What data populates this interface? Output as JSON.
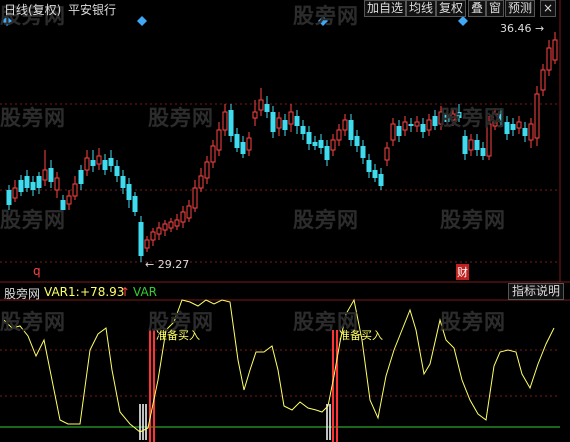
{
  "header": {
    "period": "日线(复权)",
    "stock": "平安银行",
    "buttons": [
      "加自选",
      "均线",
      "复权",
      "叠",
      "窗",
      "预测"
    ],
    "close_symbol": "×"
  },
  "price_chart": {
    "high_label": "36.46",
    "low_label": "29.27",
    "marker_q": "q",
    "marker_cai": "财"
  },
  "indicator": {
    "name": "股旁网",
    "var1_label": "VAR1:",
    "var1_value": "+78.93",
    "arrow": "↑",
    "var2_label": "VAR",
    "explain_button": "指标说明",
    "signal_text": "准备买入"
  },
  "watermarks": [
    "股旁网",
    "股旁网",
    "股旁网",
    "股旁网",
    "股旁网",
    "股旁网",
    "股旁网",
    "股旁网",
    "股旁网",
    "股旁网",
    "股旁网",
    "股旁网"
  ],
  "colors": {
    "up": "#ff4444",
    "down": "#3fdcf0",
    "line": "#ffff66",
    "grid": "#7a1a1a",
    "signal": "#ff3333",
    "baseline": "#33cc33"
  }
}
